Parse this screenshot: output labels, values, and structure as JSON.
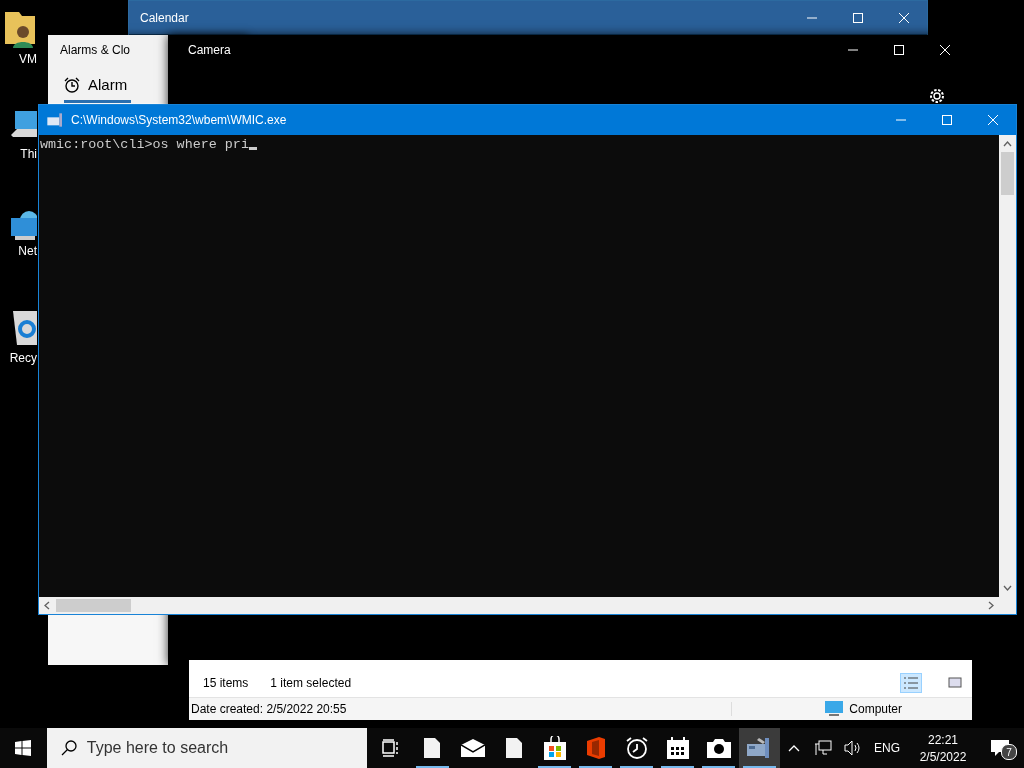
{
  "desktop_icons": [
    {
      "kind": "user-folder",
      "label": "VM"
    },
    {
      "kind": "computer",
      "label": "Thi"
    },
    {
      "kind": "network",
      "label": "Net"
    },
    {
      "kind": "recycle",
      "label": "Recy"
    }
  ],
  "windows": [
    {
      "kind": "calendar",
      "title": "Calendar"
    },
    {
      "kind": "alarms",
      "title": "Alarms & Clo",
      "tabs": [
        {
          "label": "Alarm",
          "selected": true
        }
      ]
    },
    {
      "kind": "camera",
      "title": "Camera"
    },
    {
      "kind": "explorer",
      "item_count": "15 items",
      "selection": "1 item selected",
      "details": "Date created: 2/5/2022 20:55",
      "location": "Computer"
    },
    {
      "kind": "console",
      "title": "C:\\Windows\\System32\\wbem\\WMIC.exe",
      "lines": [
        "wmic:root\\cli>os where pri"
      ]
    }
  ],
  "taskbar": {
    "search": {
      "placeholder": "Type here to search"
    },
    "apps": [
      {
        "kind": "task-view",
        "running": false,
        "active": false
      },
      {
        "kind": "document",
        "running": true,
        "active": false
      },
      {
        "kind": "mail",
        "running": false,
        "active": false
      },
      {
        "kind": "document",
        "running": false,
        "active": false
      },
      {
        "kind": "store",
        "running": true,
        "active": false
      },
      {
        "kind": "office",
        "running": true,
        "active": false
      },
      {
        "kind": "alarm-clock",
        "running": true,
        "active": false
      },
      {
        "kind": "calendar",
        "running": true,
        "active": false
      },
      {
        "kind": "camera",
        "running": true,
        "active": false
      },
      {
        "kind": "console",
        "running": true,
        "active": true
      }
    ],
    "tray": {
      "language": "ENG",
      "time": "22:21",
      "date": "2/5/2022",
      "notifications": "7"
    }
  }
}
